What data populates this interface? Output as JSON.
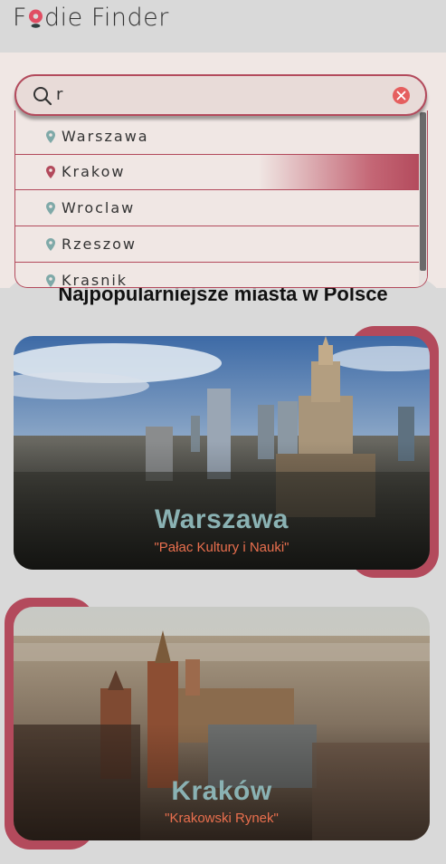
{
  "app": {
    "logo_text_1": "F",
    "logo_text_2": "die Finder"
  },
  "search": {
    "value": "r"
  },
  "suggestions": [
    "Warszawa",
    "Krakow",
    "Wroclaw",
    "Rzeszow",
    "Krasnik"
  ],
  "section_title": "Najpopularniejsze miasta w Polsce",
  "cities": [
    {
      "name": "Warszawa",
      "landmark": "\"Pałac Kultury i Nauki\""
    },
    {
      "name": "Kraków",
      "landmark": "\"Krakowski Rynek\""
    }
  ],
  "colors": {
    "accent": "#b34a5c",
    "teal": "#8ab2b3",
    "orange": "#e96f4e",
    "pin_teal": "#7fa9a8"
  },
  "icons": [
    "search-icon",
    "clear-icon",
    "map-pin-icon"
  ]
}
